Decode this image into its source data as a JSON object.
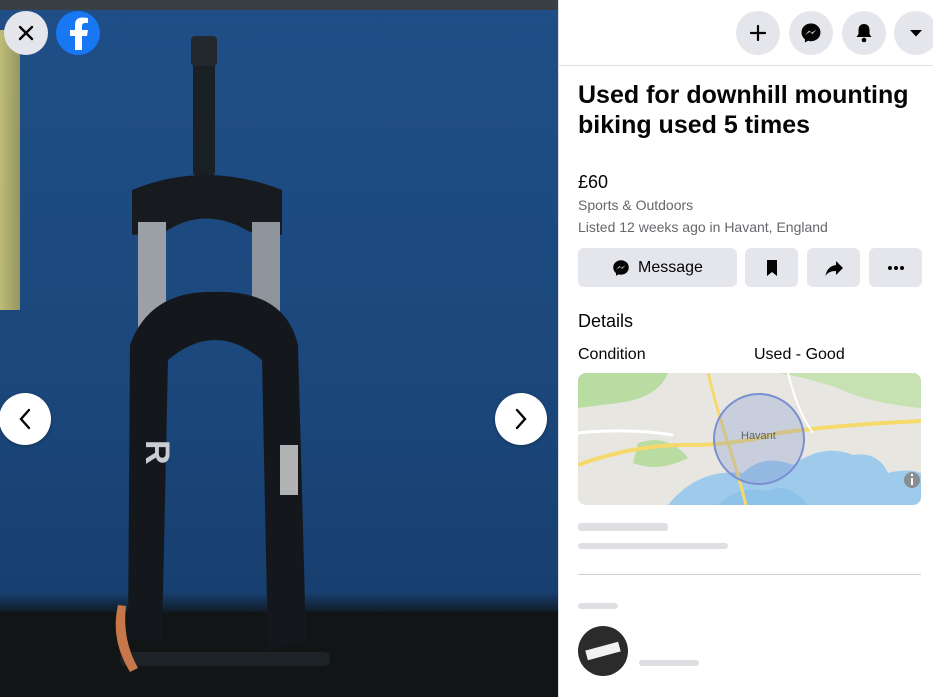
{
  "viewer": {
    "close_icon": "close-icon",
    "logo_icon": "facebook-logo-icon",
    "prev_icon": "chevron-left-icon",
    "next_icon": "chevron-right-icon"
  },
  "header": {
    "icons": [
      "plus-icon",
      "messenger-icon",
      "bell-icon",
      "caret-down-icon"
    ]
  },
  "listing": {
    "title": "Used for downhill mounting biking used 5 times",
    "price": "£60",
    "category": "Sports & Outdoors",
    "listed": "Listed 12 weeks ago in Havant, England"
  },
  "actions": {
    "message_label": "Message",
    "icons": [
      "messenger-icon",
      "bookmark-icon",
      "share-icon",
      "more-icon"
    ]
  },
  "details": {
    "heading": "Details",
    "condition_label": "Condition",
    "condition_value": "Used - Good"
  },
  "map": {
    "place_label": "Havant",
    "info_icon": "info-icon",
    "colors": {
      "water": "#9ecbec",
      "land": "#e8e6e1",
      "green": "#b9dca2",
      "road": "#f6d96b",
      "circle": "#7a8fd0"
    }
  },
  "colors": {
    "brand": "#1877f2",
    "button_bg": "#e4e6eb",
    "text": "#050505",
    "muted": "#65676b"
  }
}
